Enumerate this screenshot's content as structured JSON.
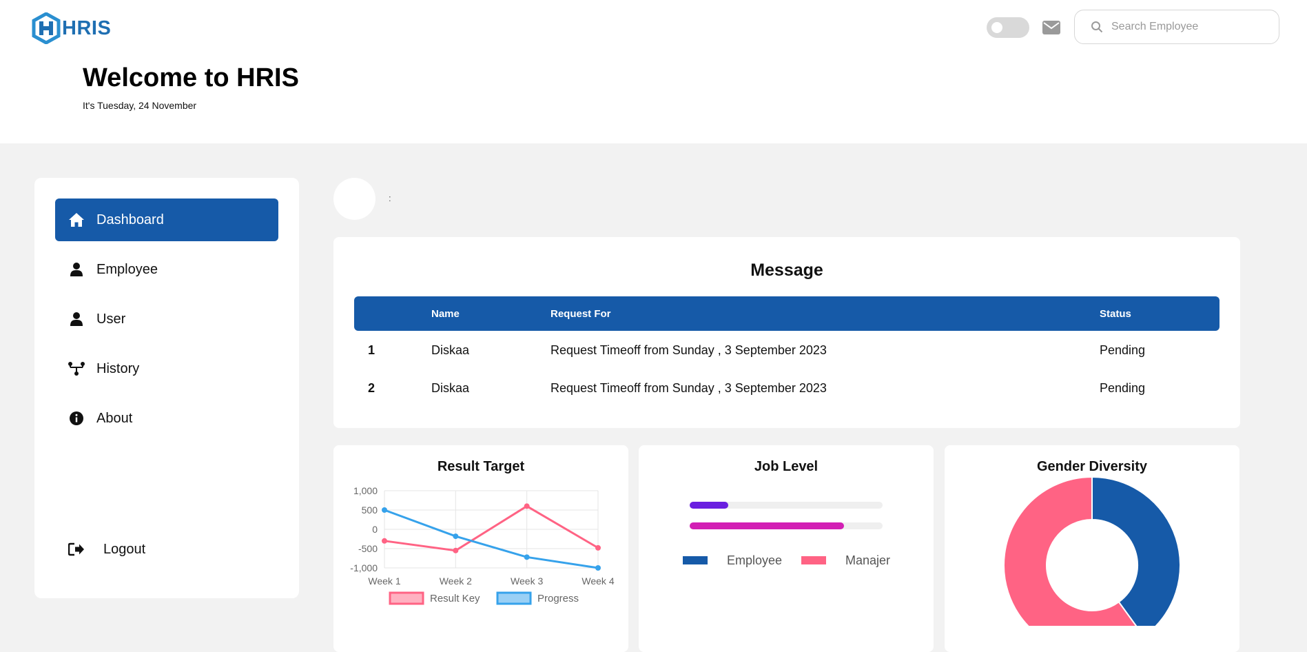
{
  "header": {
    "logo_text": "HRIS",
    "search_placeholder": "Search Employee",
    "welcome_title": "Welcome to HRIS",
    "date_text": "It's Tuesday, 24 November"
  },
  "sidebar": {
    "items": [
      {
        "label": "Dashboard",
        "icon": "home-icon",
        "active": true
      },
      {
        "label": "Employee",
        "icon": "person-icon",
        "active": false
      },
      {
        "label": "User",
        "icon": "person-icon",
        "active": false
      },
      {
        "label": "History",
        "icon": "network-icon",
        "active": false
      },
      {
        "label": "About",
        "icon": "info-icon",
        "active": false
      }
    ],
    "logout_label": "Logout"
  },
  "profile": {
    "separator": ":"
  },
  "message": {
    "title": "Message",
    "columns": [
      "Name",
      "Request For",
      "Status"
    ],
    "rows": [
      {
        "no": "1",
        "name": "Diskaa",
        "request": "Request Timeoff from Sunday , 3 September 2023",
        "status": "Pending"
      },
      {
        "no": "2",
        "name": "Diskaa",
        "request": "Request Timeoff from Sunday , 3 September 2023",
        "status": "Pending"
      }
    ]
  },
  "charts": {
    "result_target_title": "Result Target",
    "job_level_title": "Job Level",
    "gender_title": "Gender Diversity"
  },
  "colors": {
    "primary": "#165aa8",
    "pink": "#ff6384",
    "blue": "#36a2eb",
    "purple": "#6a1fe0",
    "magenta": "#d21fb4"
  },
  "chart_data": [
    {
      "type": "line",
      "title": "Result Target",
      "x": [
        "Week 1",
        "Week 2",
        "Week 3",
        "Week 4"
      ],
      "y_ticks": [
        "1,000",
        "500",
        "0",
        "-500",
        "-1,000"
      ],
      "ylim": [
        -1000,
        1000
      ],
      "grid": true,
      "legend": "bottom",
      "series": [
        {
          "name": "Result Key",
          "color": "#ff6384",
          "values": [
            -300,
            -550,
            600,
            -480
          ]
        },
        {
          "name": "Progress",
          "color": "#36a2eb",
          "values": [
            500,
            -180,
            -720,
            -1000
          ]
        }
      ]
    },
    {
      "type": "bar",
      "title": "Job Level",
      "legend": "bottom",
      "bars": [
        {
          "color": "#6a1fe0",
          "fraction": 0.2
        },
        {
          "color": "#d21fb4",
          "fraction": 0.8
        }
      ],
      "legend_items": [
        {
          "name": "Employee",
          "color": "#165aa8"
        },
        {
          "name": "Manajer",
          "color": "#ff6384"
        }
      ]
    },
    {
      "type": "pie",
      "title": "Gender Diversity",
      "donut": true,
      "slices": [
        {
          "color": "#165aa8",
          "value": 40
        },
        {
          "color": "#ff6384",
          "value": 60
        }
      ]
    }
  ]
}
